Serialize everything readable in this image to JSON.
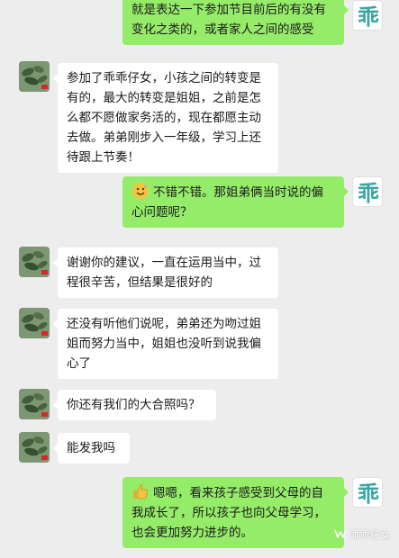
{
  "messages": [
    {
      "side": "right",
      "text": "就是表达一下参加节目前后的有没有变化之类的，或者家人之间的感受"
    },
    {
      "side": "left",
      "text": "参加了乖乖仔女，小孩之间的转变是有的，最大的转变是姐姐，之前是怎么都不愿做家务活的，现在都愿主动去做。弟弟刚步入一年级，学习上还待跟上节奏！"
    },
    {
      "side": "right",
      "emoji": "sweat-smile-emoji",
      "text": "不错不错。那姐弟俩当时说的偏心问题呢？"
    },
    {
      "side": "left",
      "text": "谢谢你的建议，一直在运用当中，过程很辛苦，但结果是很好的"
    },
    {
      "side": "left",
      "text": "还没有听他们说呢，弟弟还为吻过姐姐而努力当中，姐姐也没听到说我偏心了"
    },
    {
      "side": "left",
      "text": "你还有我们的大合照吗？"
    },
    {
      "side": "left",
      "text": "能发我吗"
    },
    {
      "side": "right",
      "emoji": "thumbs-up-emoji",
      "text": "嗯嗯，看来孩子感受到父母的自我成长了，所以孩子也向父母学习，也会更加努力进步的。"
    }
  ],
  "watermark": {
    "text": "乖乖仔女",
    "icon": "wechat-channel-icon"
  },
  "colors": {
    "background": "#ededed",
    "sent_bubble": "#95ec69",
    "received_bubble": "#ffffff"
  }
}
